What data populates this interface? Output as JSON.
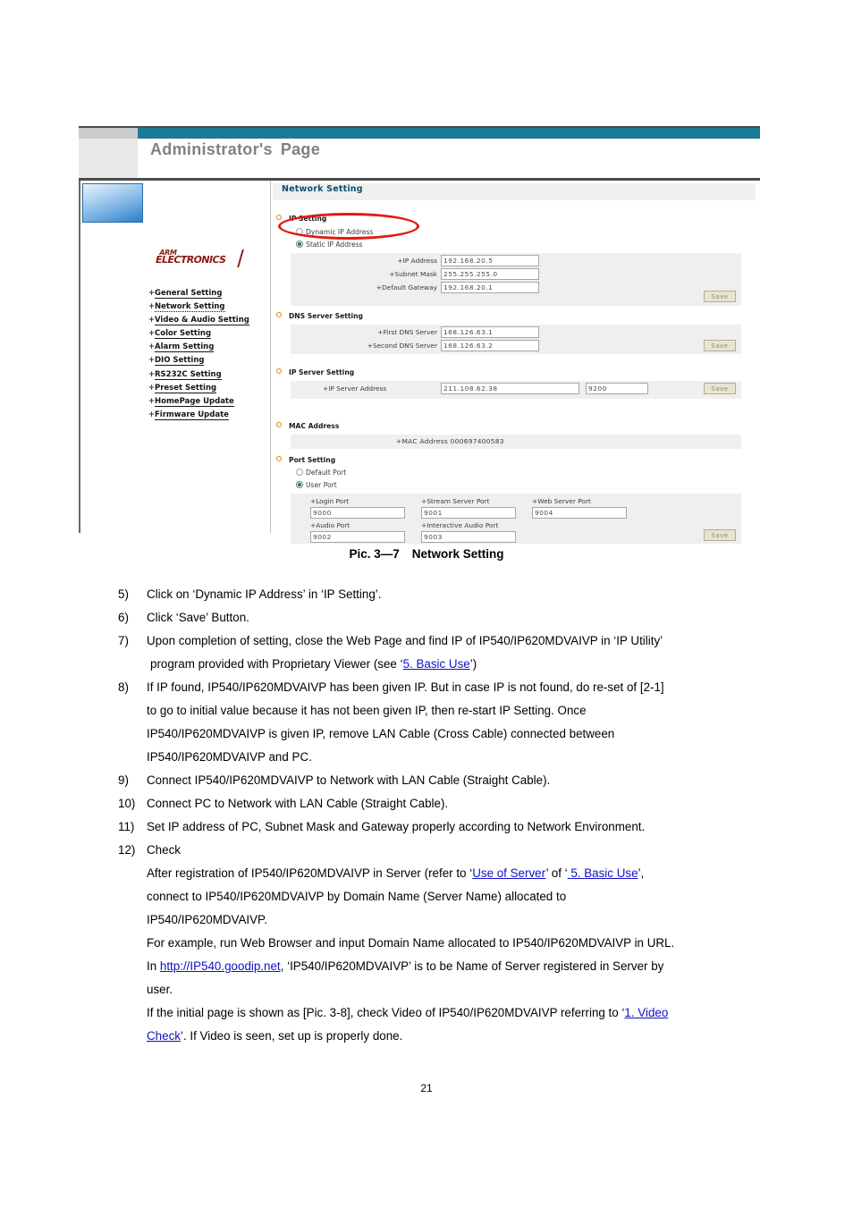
{
  "figure": {
    "header": {
      "title_part1": "Administrator's",
      "title_part2": "Page"
    },
    "sidebar": {
      "brand_top": "ARM",
      "brand_bottom": "ELECTRONICS",
      "items": [
        {
          "label": "General Setting",
          "active": false
        },
        {
          "label": "Network Setting",
          "active": true
        },
        {
          "label": "Video & Audio Setting",
          "active": false
        },
        {
          "label": "Color Setting",
          "active": false
        },
        {
          "label": "Alarm Setting",
          "active": false
        },
        {
          "label": "DIO Setting",
          "active": false
        },
        {
          "label": "RS232C Setting",
          "active": false
        },
        {
          "label": "Preset Setting",
          "active": false
        },
        {
          "label": "HomePage Update",
          "active": false
        },
        {
          "label": "Firmware Update",
          "active": false
        }
      ]
    },
    "content": {
      "page_title": "Network Setting",
      "ip_setting": {
        "heading": "IP Setting",
        "option_dynamic": "Dynamic IP Address",
        "option_static": "Static IP Address",
        "fields": [
          {
            "label": "+IP Address",
            "value": "192.168.20.5"
          },
          {
            "label": "+Subnet Mask",
            "value": "255.255.255.0"
          },
          {
            "label": "+Default Gateway",
            "value": "192.168.20.1"
          }
        ],
        "save_label": "Save"
      },
      "dns_setting": {
        "heading": "DNS Server Setting",
        "fields": [
          {
            "label": "+First DNS Server",
            "value": "168.126.63.1"
          },
          {
            "label": "+Second DNS Server",
            "value": "168.126.63.2"
          }
        ],
        "save_label": "Save"
      },
      "ip_server_setting": {
        "heading": "IP Server Setting",
        "field_label": "+IP Server Address",
        "address_value": "211.108.62.38",
        "port_value": "9200",
        "save_label": "Save"
      },
      "mac_address": {
        "heading": "MAC Address",
        "row_text": "+MAC Address 000697400583"
      },
      "port_setting": {
        "heading": "Port Setting",
        "option_default": "Default Port",
        "option_user": "User Port",
        "fields": [
          {
            "label": "+Login Port",
            "value": "9000"
          },
          {
            "label": "+Stream Server Port",
            "value": "9001"
          },
          {
            "label": "+Web Server Port",
            "value": "9004"
          },
          {
            "label": "+Audio Port",
            "value": "9002"
          },
          {
            "label": "+Interactive Audio Port",
            "value": "9003"
          }
        ],
        "save_label": "Save"
      }
    },
    "colors": {
      "header_band": "#1b7b96",
      "title_text": "#0d5070",
      "bullet": "#f08000",
      "annotation": "#e01b12",
      "brand": "#8a1a12",
      "link": "#1010c8"
    }
  },
  "caption": {
    "prefix": "Pic. 3—7",
    "title": "Network Setting"
  },
  "steps": {
    "s5": {
      "num": "5)",
      "text": "Click on ‘Dynamic IP Address’ in ‘IP Setting’."
    },
    "s6": {
      "num": "6)",
      "text": "Click ‘Save’ Button."
    },
    "s7": {
      "num": "7)",
      "line1": "Upon completion of setting, close the Web Page and find IP of IP540/IP620MDVAIVP in ‘IP Utility’",
      "line2_pre": "program provided with Proprietary Viewer (see ‘",
      "line2_link": "5. Basic Use",
      "line2_post": "’)"
    },
    "s8": {
      "num": "8)",
      "line1": "If IP found, IP540/IP620MDVAIVP has been given IP. But in case IP is not found, do re-set of [2-1]",
      "line2": "to go to initial value because it has not been given IP, then re-start IP Setting. Once",
      "line3": "IP540/IP620MDVAIVP is given IP, remove LAN Cable (Cross Cable) connected between",
      "line4": "IP540/IP620MDVAIVP and PC."
    },
    "s9": {
      "num": "9)",
      "text": "Connect IP540/IP620MDVAIVP to Network with LAN Cable (Straight Cable)."
    },
    "s10": {
      "num": "10)",
      "text": "Connect PC to Network with LAN Cable (Straight Cable)."
    },
    "s11": {
      "num": "11)",
      "text": "Set IP address of PC, Subnet Mask and Gateway properly according to Network Environment."
    },
    "s12": {
      "num": "12)",
      "text": "Check",
      "p1_pre": "After registration of IP540/IP620MDVAIVP in Server (refer to ‘",
      "p1_link1": "Use of   Server",
      "p1_mid": "’ of ‘",
      "p1_link2": " 5. Basic Use",
      "p1_post": "’,",
      "p2": "connect to IP540/IP620MDVAIVP by Domain Name (Server Name) allocated to",
      "p3": "IP540/IP620MDVAIVP.",
      "p4": "For example, run Web Browser and input Domain Name allocated to IP540/IP620MDVAIVP in URL.",
      "p5_pre": "In ",
      "p5_link": "http://IP540.goodip.net",
      "p5_post": ", ‘IP540/IP620MDVAIVP’ is to be Name of Server registered in Server by",
      "p6": "user.",
      "p7_pre": "If the initial page is shown as [Pic. 3-8], check Video of IP540/IP620MDVAIVP referring to ‘",
      "p7_link": "1. Video ",
      "p8_link": "Check",
      "p8_post": "’.    If Video is seen, set up is properly done."
    }
  },
  "footer": {
    "page_number": "21"
  }
}
